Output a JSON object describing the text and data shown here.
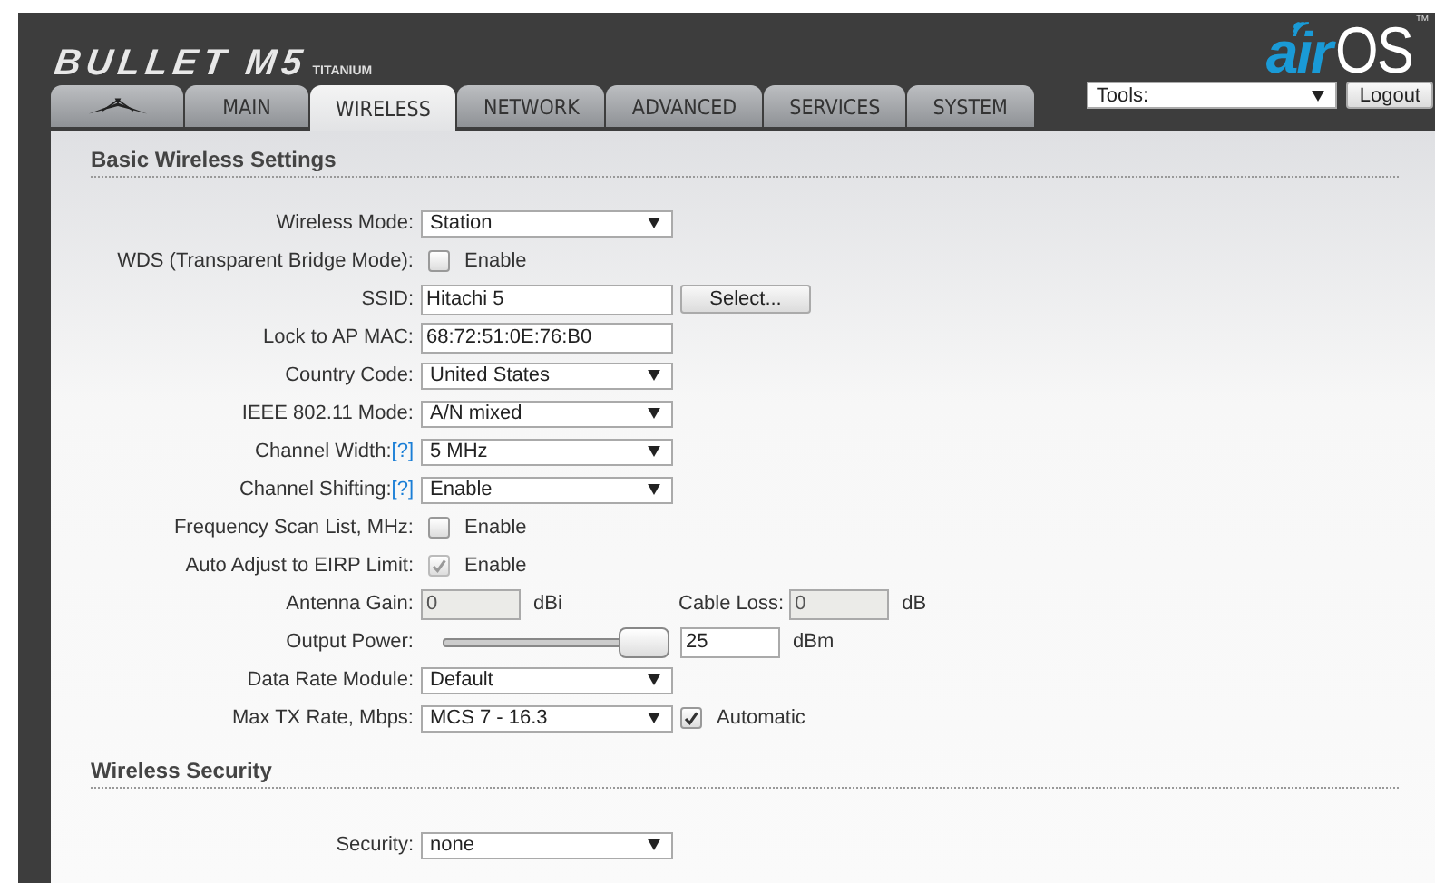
{
  "header": {
    "product": "BULLET M5",
    "edition": "TITANIUM",
    "brand": "air",
    "brand_suffix": "OS",
    "trademark": "™"
  },
  "tabs": [
    {
      "kind": "logo",
      "selected": false
    },
    {
      "label": "MAIN",
      "selected": false
    },
    {
      "label": "WIRELESS",
      "selected": true
    },
    {
      "label": "NETWORK",
      "selected": false
    },
    {
      "label": "ADVANCED",
      "selected": false
    },
    {
      "label": "SERVICES",
      "selected": false
    },
    {
      "label": "SYSTEM",
      "selected": false
    }
  ],
  "tools": {
    "value": "Tools:",
    "button": "Logout"
  },
  "sections": [
    {
      "title": "Basic Wireless Settings",
      "rows": [
        {
          "kind": "select",
          "label": "Wireless Mode:",
          "value": "Station"
        },
        {
          "kind": "checkbox",
          "label": "WDS (Transparent Bridge Mode):",
          "checked": false,
          "disabled": false,
          "text": "Enable"
        },
        {
          "kind": "input",
          "label": "SSID:",
          "value": "Hitachi 5",
          "button": "Select..."
        },
        {
          "kind": "input",
          "label": "Lock to AP MAC:",
          "value": "68:72:51:0E:76:B0"
        },
        {
          "kind": "select",
          "label": "Country Code:",
          "value": "United States"
        },
        {
          "kind": "select",
          "label": "IEEE 802.11 Mode:",
          "value": "A/N mixed"
        },
        {
          "kind": "select",
          "label": "Channel Width:",
          "help": "[?]",
          "value": "5 MHz"
        },
        {
          "kind": "select",
          "label": "Channel Shifting:",
          "help": "[?]",
          "value": "Enable"
        },
        {
          "kind": "checkbox",
          "label": "Frequency Scan List, MHz:",
          "checked": false,
          "disabled": false,
          "text": "Enable"
        },
        {
          "kind": "checkbox",
          "label": "Auto Adjust to EIRP Limit:",
          "checked": true,
          "disabled": true,
          "text": "Enable"
        },
        {
          "kind": "gain",
          "label": "Antenna Gain:",
          "value": "0",
          "unit": "dBi",
          "disabled": true,
          "label2": "Cable Loss:",
          "value2": "0",
          "unit2": "dB"
        },
        {
          "kind": "slider",
          "label": "Output Power:",
          "level": 1,
          "value": "25",
          "unit": "dBm"
        },
        {
          "kind": "select",
          "label": "Data Rate Module:",
          "value": "Default"
        },
        {
          "kind": "select",
          "label": "Max TX Rate, Mbps:",
          "value": "MCS 7 - 16.3",
          "option": {
            "checked": true,
            "text": "Automatic"
          }
        }
      ]
    },
    {
      "title": "Wireless Security",
      "rows": [
        {
          "kind": "select",
          "label": "Security:",
          "value": "none"
        }
      ]
    }
  ]
}
